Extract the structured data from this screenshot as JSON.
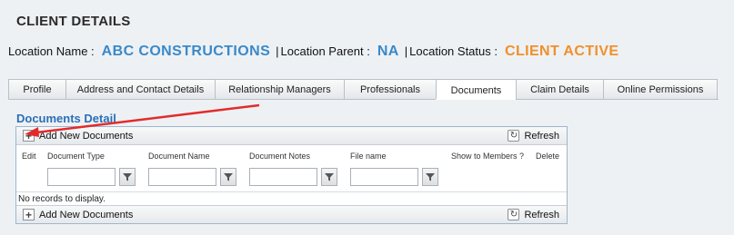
{
  "page_title": "CLIENT DETAILS",
  "location": {
    "name_label": "Location Name :",
    "name_value": "ABC CONSTRUCTIONS",
    "separator": "|",
    "parent_label": "Location Parent :",
    "parent_value": "NA",
    "status_label": "Location Status :",
    "status_value": "CLIENT ACTIVE",
    "value_color": "#3a89c9",
    "status_color": "#f0902a"
  },
  "tabs": [
    {
      "label": "Profile",
      "active": false
    },
    {
      "label": "Address and Contact Details",
      "active": false
    },
    {
      "label": "Relationship Managers",
      "active": false
    },
    {
      "label": "Professionals",
      "active": false
    },
    {
      "label": "Documents",
      "active": true
    },
    {
      "label": "Claim Details",
      "active": false
    },
    {
      "label": "Online Permissions",
      "active": false
    }
  ],
  "section_title": "Documents Detail",
  "grid": {
    "add_label": "Add New Documents",
    "refresh_label": "Refresh",
    "columns": [
      "Edit",
      "Document Type",
      "Document Name",
      "Document Notes",
      "File name",
      "Show to Members ?",
      "Delete"
    ],
    "empty_text": "No records to display.",
    "icons": {
      "add": "plus-icon",
      "refresh": "refresh-icon",
      "filter": "filter-icon"
    }
  },
  "annotation": {
    "arrow_color": "#e32b2b"
  }
}
